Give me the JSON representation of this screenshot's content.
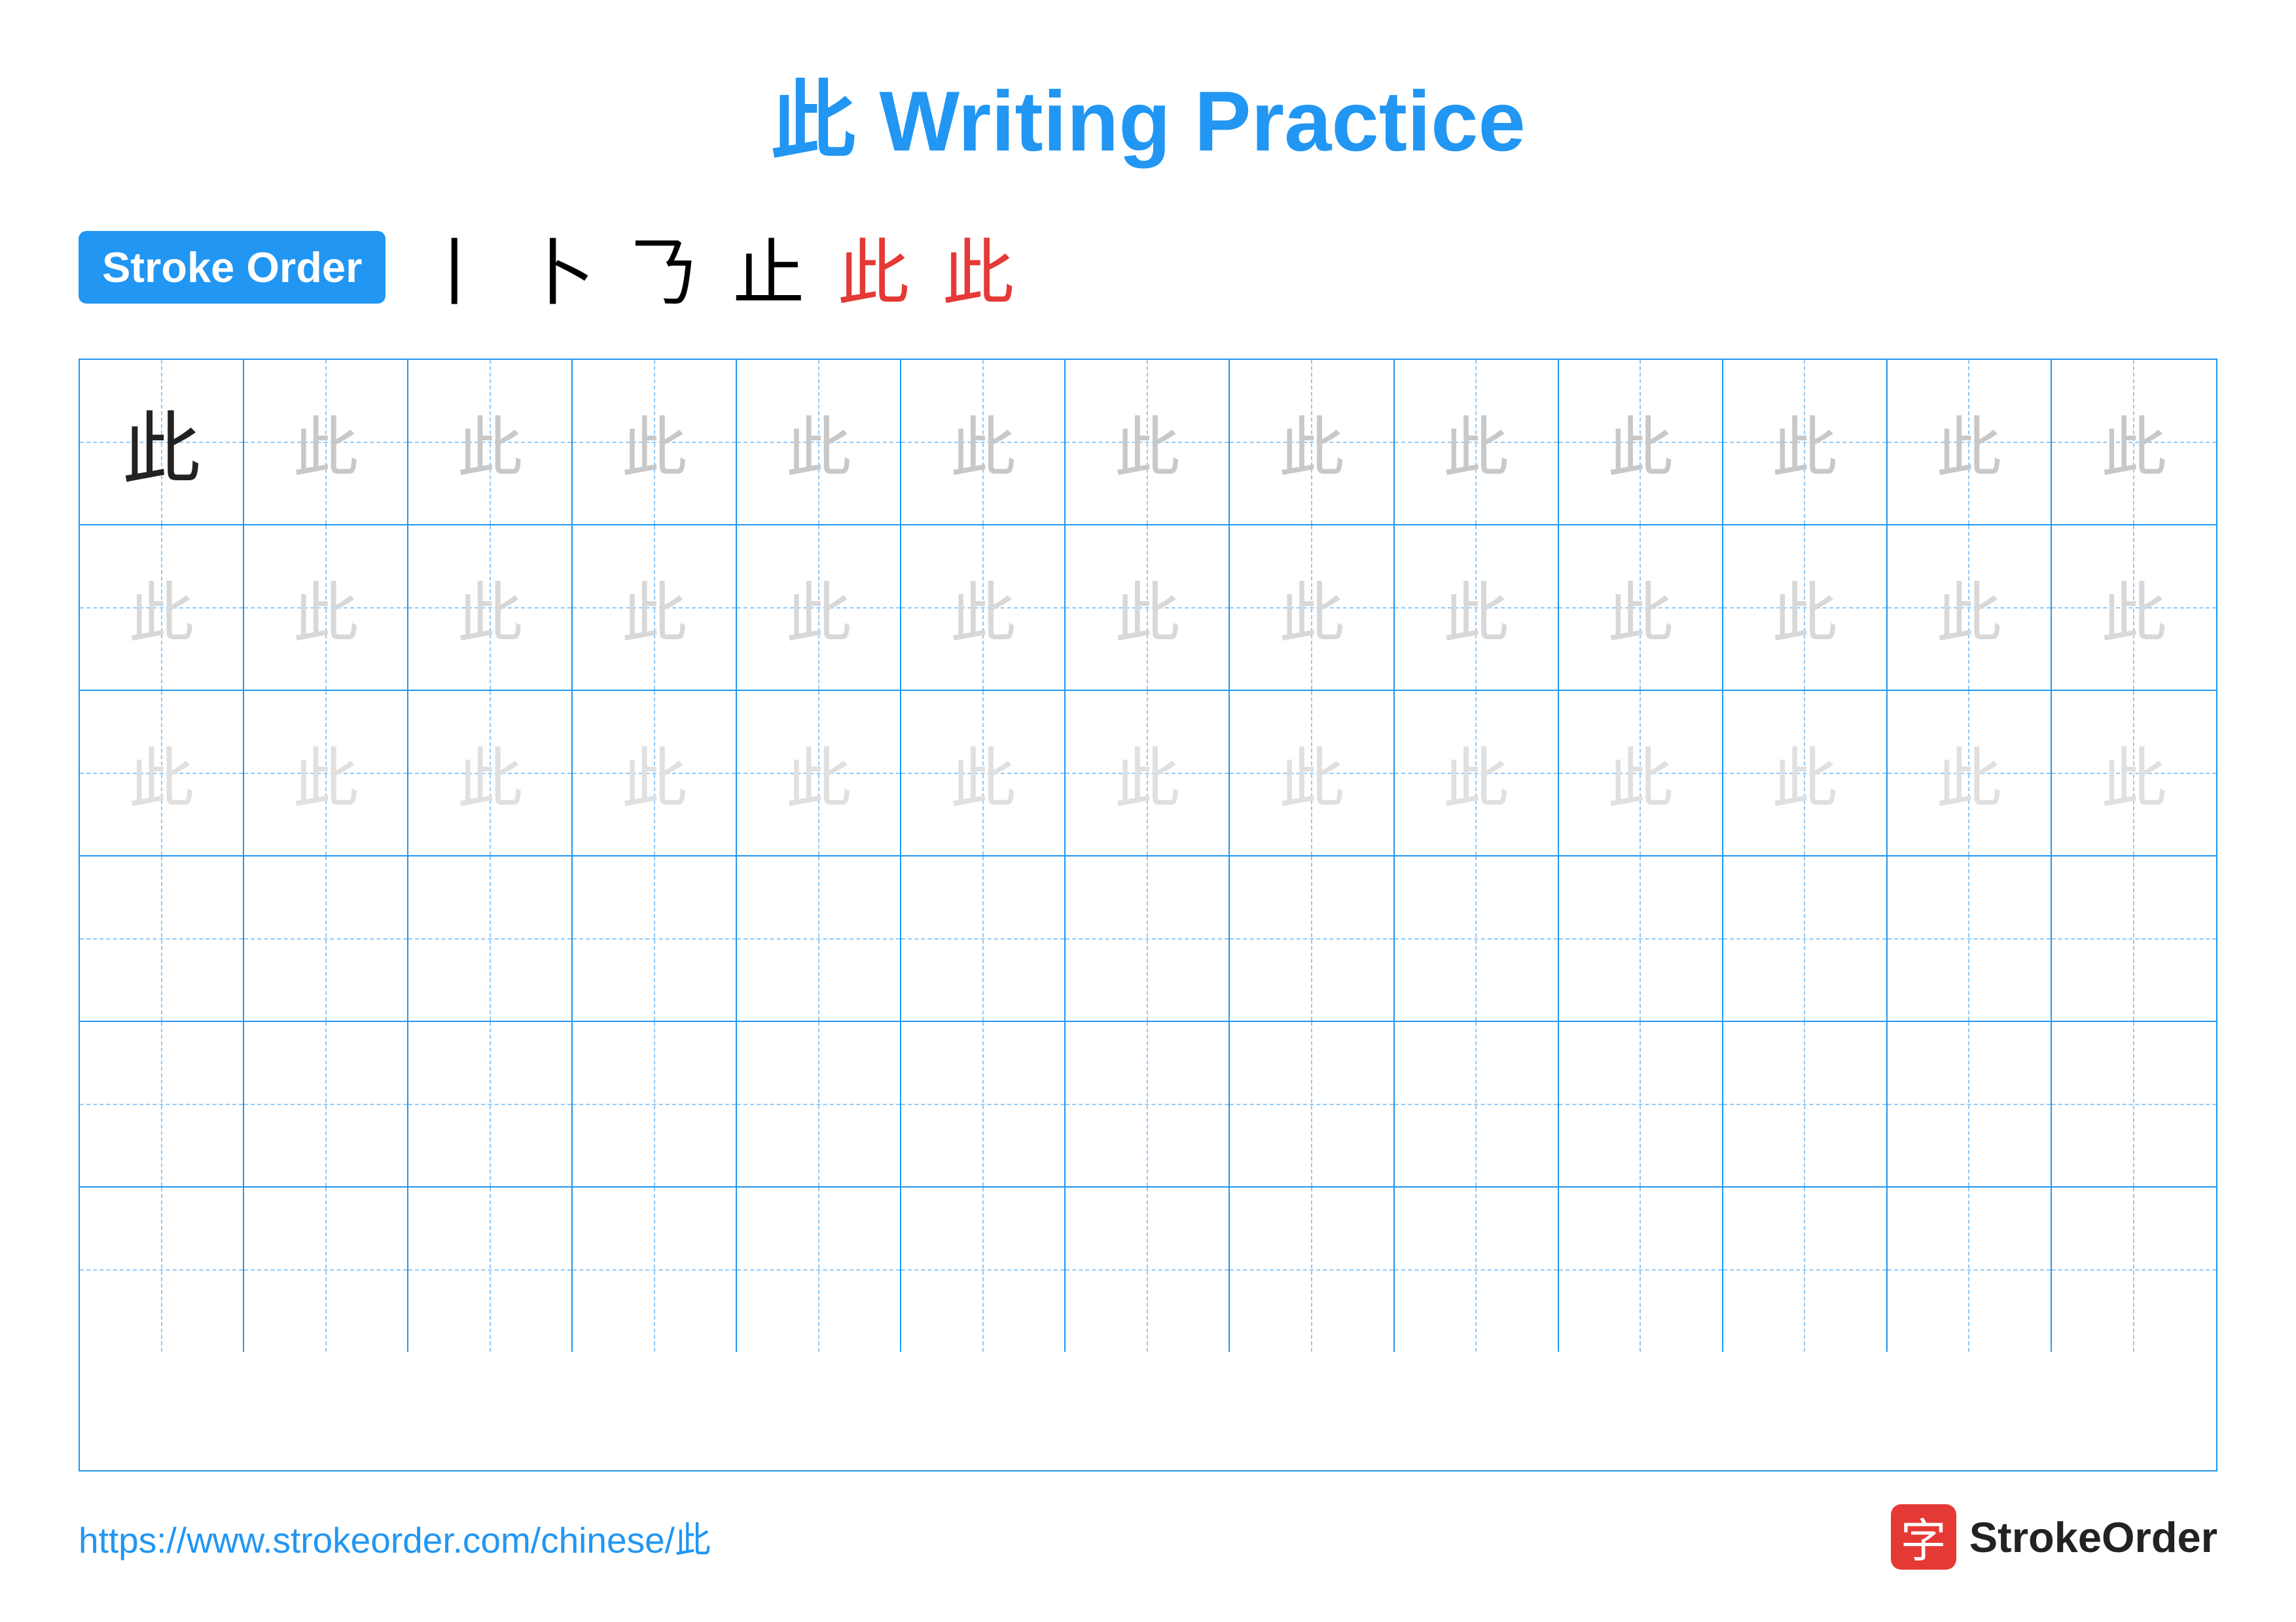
{
  "title": {
    "chinese_char": "此",
    "text": "此 Writing Practice"
  },
  "stroke_order": {
    "badge_label": "Stroke Order",
    "steps": [
      "丨",
      "𠄌",
      "𠄎",
      "止",
      "此",
      "此"
    ]
  },
  "grid": {
    "rows": 6,
    "cols": 13,
    "char": "此",
    "row_types": [
      "dark+light1",
      "light2",
      "lighter",
      "empty",
      "empty",
      "empty"
    ]
  },
  "footer": {
    "url": "https://www.strokeorder.com/chinese/此",
    "logo_char": "字",
    "logo_name": "StrokeOrder"
  }
}
